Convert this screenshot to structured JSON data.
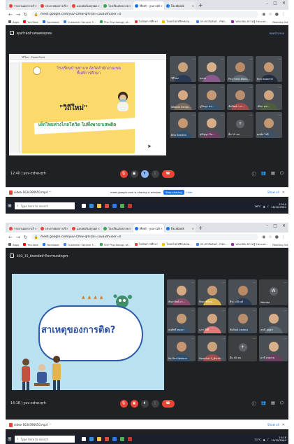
{
  "shot1": {
    "tabs": [
      {
        "label": "รายงานผลการเรียนรู้ประจำ...",
        "color": "#ea4335",
        "active": false
      },
      {
        "label": "ประกาศผลการเรียน 1...",
        "color": "#ea4335",
        "active": false
      },
      {
        "label": "แบบฟอร์มสรุปผลการ...",
        "color": "#ea4335",
        "active": false
      },
      {
        "label": "โรงเรียนวัดบางพระ...",
        "color": "#34a853",
        "active": false
      },
      {
        "label": "Meet - yuv-czhw-...",
        "color": "#1a73e8",
        "active": true
      },
      {
        "label": "Facebook",
        "color": "#1877f2",
        "active": false
      }
    ],
    "url": "meet.google.com/yuv-czhw-qrh?pli=1&authuser=0",
    "bookmarks": [
      "Apps",
      "YouTube",
      "Facebook",
      "Customer Service F...",
      "The Psychology of...",
      "ไลฟ์สดการศึกษา",
      "โหลดไฟล์ฟรีPdfเล่ม...",
      "ประชาสัมพันธ์ - PNB...",
      "Wikiสอน ความรู้ Educati..."
    ],
    "bookmarks_end": "Reading list",
    "meet_title": "คุณกำลังนำเสนอต่อทุกคน",
    "meet_right": "หยุดนำเสนอ",
    "slide": {
      "file_title": "วิถีใหม่ - PowerPoint",
      "heading": "โรงเรียนบ้านท่าแห สังกัดสำนักงานเขตพื้นที่การศึกษา",
      "big": "\"วิถีใหม่\"",
      "sub": "เด็กไทยห่างไกลโควิด ไม่พึ่งพายาเสพติด"
    },
    "participants": [
      {
        "name": "วิถีใหม่",
        "avatar": false,
        "face": "#c8a27c",
        "shirt": "#2b3a55"
      },
      {
        "name": "หมวย",
        "avatar": false,
        "face": "#d9b08c",
        "shirt": "#8a5a8c"
      },
      {
        "name": "Pov mest Wanc...",
        "avatar": false,
        "face": "#b88a66",
        "shirt": "#5c6b73"
      },
      {
        "name": "Bnu Boonme",
        "avatar": false,
        "face": "#c89a74",
        "shirt": "#1f2c3d"
      },
      {
        "name": "Wasida Sangp...",
        "avatar": false,
        "face": "#d4a984",
        "shirt": "#7a6a58"
      },
      {
        "name": "ภูริชญา พร...",
        "avatar": false,
        "face": "#c49a76",
        "shirt": "#38526b"
      },
      {
        "name": "ชัยวัฒน์ การ...",
        "avatar": false,
        "face": "#b98e6c",
        "shirt": "#a34b4b"
      },
      {
        "name": "วนิดา สุข...",
        "avatar": false,
        "face": "#d1a57e",
        "shirt": "#4d5e3f"
      },
      {
        "name": "Bhu Bandan",
        "avatar": false,
        "face": "#c59872",
        "shirt": "#2f4f6f"
      },
      {
        "name": "สุกัญญา จัน...",
        "avatar": false,
        "face": "#d6ad88",
        "shirt": "#6b3f5f"
      },
      {
        "name": "อื่น 19 คน",
        "avatar": true,
        "initial": "+"
      },
      {
        "name": "ศุภชัย ใจดี",
        "avatar": false,
        "face": "#c39872",
        "shirt": "#3e5061"
      }
    ],
    "clock": "12:40 | yuv-czhw-qrh",
    "download_file": "video-1634390650.mp4",
    "share_text": "meet.google.com is sharing a window.",
    "stop_sharing": "Stop sharing",
    "hide": "Hide",
    "show_all": "Show all",
    "taskbar_search": "Type here to search",
    "tray_time": "12:40",
    "tray_date": "16/10/2564",
    "tray_temp": "26°C"
  },
  "shot2": {
    "tabs": [
      {
        "label": "รายงานผลการเรียนรู้ป...",
        "color": "#ea4335",
        "active": false
      },
      {
        "label": "ประกาศผลการเรียน...",
        "color": "#ea4335",
        "active": false
      },
      {
        "label": "แบบฟอร์มสรุปผลการ...",
        "color": "#ea4335",
        "active": false
      },
      {
        "label": "โรงเรียนวัดบางพระ...",
        "color": "#34a853",
        "active": false
      },
      {
        "label": "Meet - yuv-czhw-...",
        "color": "#1a73e8",
        "active": true
      },
      {
        "label": "Facebook",
        "color": "#1877f2",
        "active": false
      }
    ],
    "url": "meet.google.com/yuv-czhw-qrh?pli=1&authuser=0",
    "bookmarks": [
      "Apps",
      "YouTube",
      "Facebook",
      "Customer Service F...",
      "The Psychology of...",
      "ไลฟ์สดการศึกษา",
      "โหลดไฟล์ฟรีPdfเล่ม...",
      "ประชาสัมพันธ์ - PNB...",
      "Wikiสอน ความรู้ Educati..."
    ],
    "bookmarks_end": "Reading list",
    "meet_title": "403_15_ผักสดจัดทำกิจกรรมหลักสูตร",
    "slide": {
      "big": "สาเหตุของการติด?",
      "flags": "▲▲▲▲"
    },
    "participants": [
      {
        "name": "ลัดดาวัลย์ ผา...",
        "avatar": false,
        "face": "#d4a984",
        "shirt": "#8a4c6b"
      },
      {
        "name": "ปัทมา ศรีสุข...",
        "avatar": false,
        "face": "#c89a74",
        "shirt": "#d9b64c"
      },
      {
        "name": "ธีระ มณีวงศ์",
        "avatar": false,
        "face": "#b88a66",
        "shirt": "#2b3a55"
      },
      {
        "name": "Wanida",
        "avatar": true,
        "initial": "W"
      },
      {
        "name": "สมศักดิ์ ทองมา",
        "avatar": false,
        "face": "#c49a76",
        "shirt": "#38526b"
      },
      {
        "name": "นภา ใจดี",
        "avatar": false,
        "face": "#d1a57e",
        "shirt": "#e07a7a"
      },
      {
        "name": "ชัยวัฒน์ แสงทอง",
        "avatar": false,
        "face": "#b98e6c",
        "shirt": "#3e5061"
      },
      {
        "name": "อรุณี บุญมา",
        "avatar": false,
        "face": "#d6ad88",
        "shirt": "#5c6b73"
      },
      {
        "name": "Se Der Nedsun",
        "avatar": false,
        "face": "#c59872",
        "shirt": "#2f4f6f"
      },
      {
        "name": "Somchai S_Bunth...",
        "avatar": false,
        "face": "#c8a27c",
        "shirt": "#a34b4b"
      },
      {
        "name": "อื่น 45 คน",
        "avatar": true,
        "initial": "+"
      },
      {
        "name": "มาลี สวยงาม",
        "avatar": false,
        "face": "#d9b08c",
        "shirt": "#6b3f5f"
      }
    ],
    "clock": "14:18 | yuv-czhw-qrh",
    "download_file": "video-1634390650.mp4",
    "show_all": "Show all",
    "taskbar_search": "Type here to search",
    "tray_time": "14:18",
    "tray_date": "19/10/2564",
    "tray_temp": "31°C"
  }
}
